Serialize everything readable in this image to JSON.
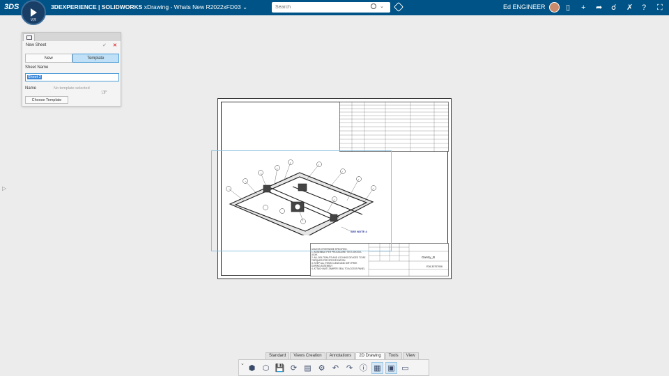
{
  "topbar": {
    "brand_prefix": "3DEXPERIENCE | SOLIDWORKS",
    "app_name": "xDrawing - Whats New R2022xFD03",
    "search_placeholder": "Search",
    "username": "Ed ENGINEER",
    "compass_label": "V,R"
  },
  "panel": {
    "title": "New Sheet",
    "seg_new": "New",
    "seg_template": "Template",
    "sheet_name_label": "Sheet Name",
    "sheet_name_value": "Sheet 2",
    "name_label": "Name",
    "name_value": "No template selected",
    "choose_button": "Choose Template"
  },
  "drawing": {
    "part_label": "Gantry_B",
    "part_number": "E26-30707006",
    "see_note": "SEE NOTE 4",
    "notes": [
      "UNLESS OTHERWISE SPECIFIED:",
      "1. ASSEMBLE PER PROCEDURE TEST-00XXXX-XXXX",
      "2. ALL BOLTS/NUTS AND LOCKING DEVICES TO BE TORQUED PER SPECIFICATION",
      "3. KEEP ALL ITEMS CLEAN AND DIRT-FREE DURING ASSEMBLY",
      "4. ATTACH ANTI-TAMPER SEAL TO ACCESS PANEL"
    ]
  },
  "bottom": {
    "tabs": [
      "Standard",
      "Views Creation",
      "Annotations",
      "2D Drawing",
      "Tools",
      "View"
    ],
    "active_tab": "2D Drawing"
  },
  "colors": {
    "topbar": "#005386",
    "accent": "#3b86d6",
    "close": "#dd3333"
  }
}
